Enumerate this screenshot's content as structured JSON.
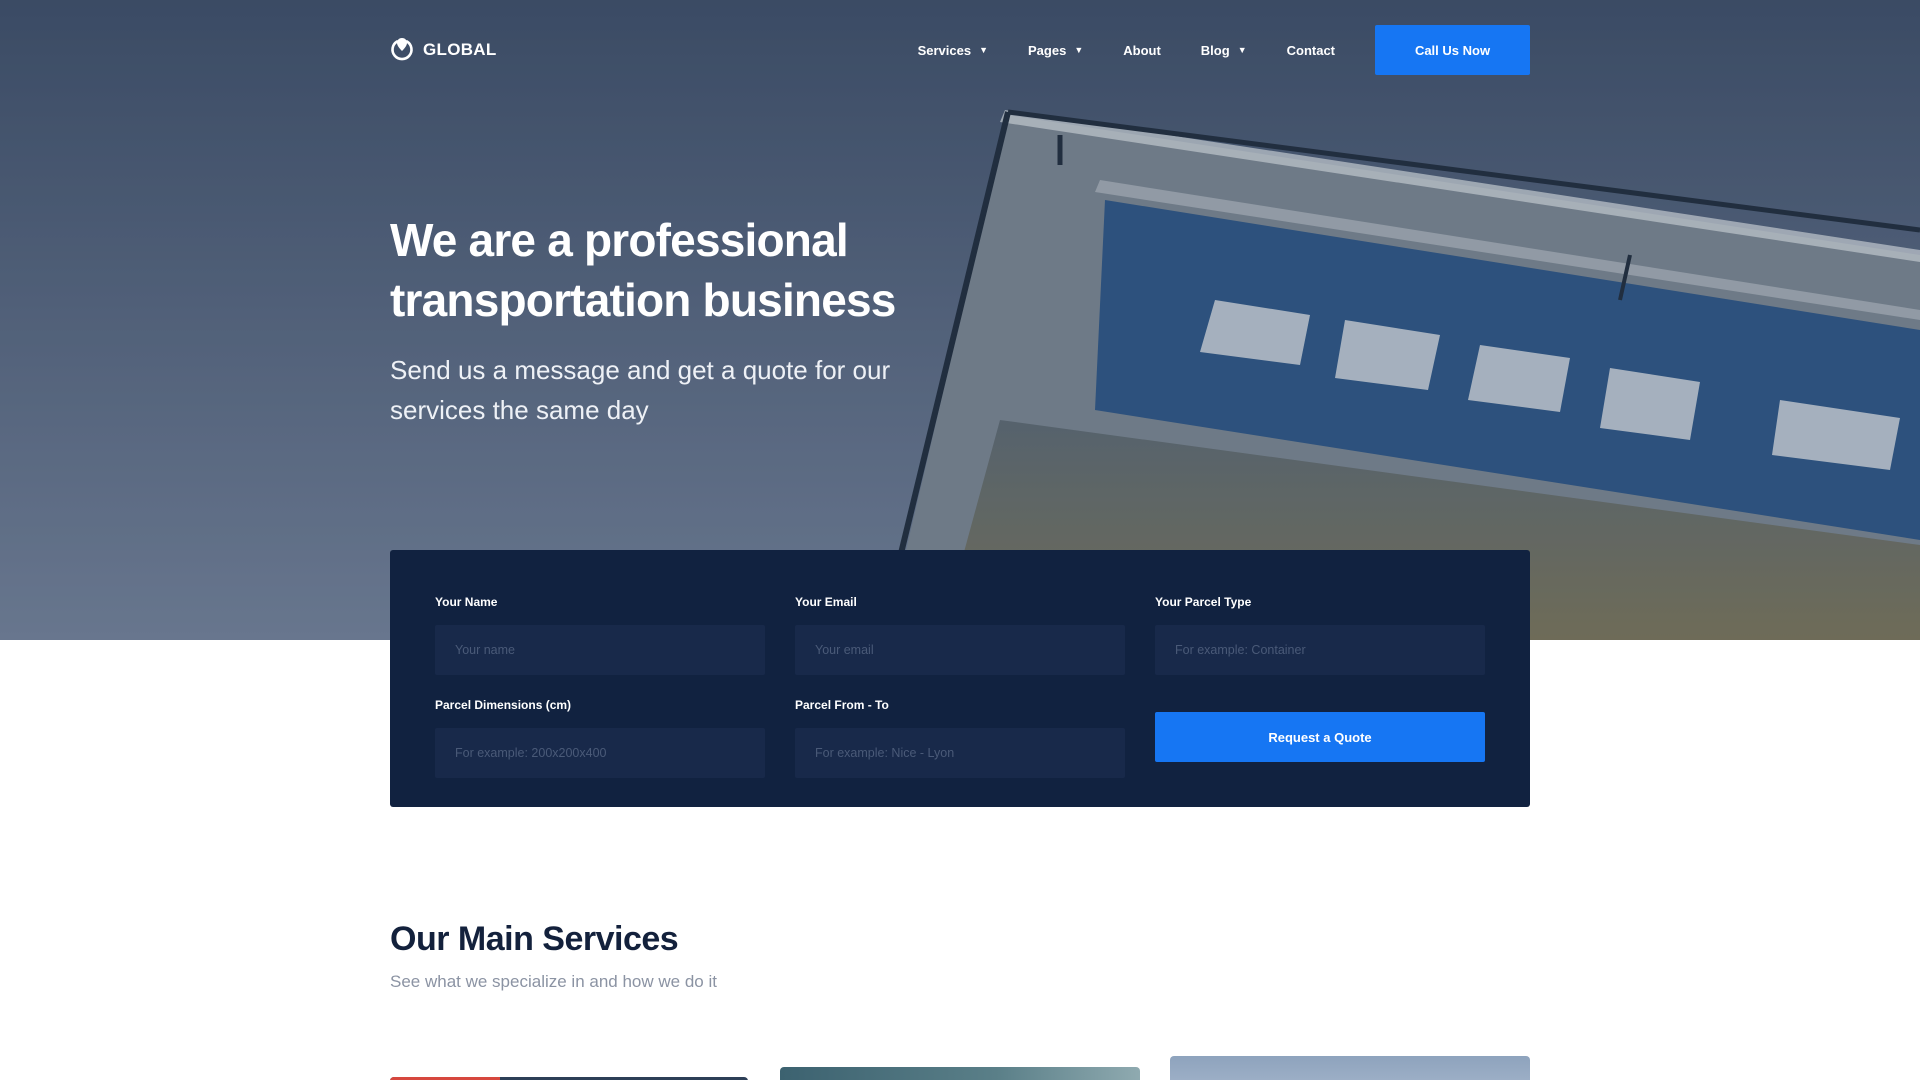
{
  "brand": {
    "name": "GLOBAL",
    "icon": "location-pin-icon"
  },
  "nav": {
    "items": [
      {
        "label": "Services",
        "dropdown": true
      },
      {
        "label": "Pages",
        "dropdown": true
      },
      {
        "label": "About",
        "dropdown": false
      },
      {
        "label": "Blog",
        "dropdown": true
      },
      {
        "label": "Contact",
        "dropdown": false
      }
    ],
    "caret": "▼",
    "cta_label": "Call Us Now"
  },
  "hero": {
    "title": "We are a professional transportation business",
    "subtitle": "Send us a message and get a quote for our services the same day"
  },
  "quote_form": {
    "fields": [
      {
        "label": "Your Name",
        "placeholder": "Your name",
        "value": ""
      },
      {
        "label": "Your Email",
        "placeholder": "Your email",
        "value": ""
      },
      {
        "label": "Your Parcel Type",
        "placeholder": "For example: Container",
        "value": ""
      },
      {
        "label": "Parcel Dimensions (cm)",
        "placeholder": "For example: 200x200x400",
        "value": ""
      },
      {
        "label": "Parcel From - To",
        "placeholder": "For example: Nice - Lyon",
        "value": ""
      }
    ],
    "submit_label": "Request a Quote"
  },
  "services": {
    "title": "Our Main Services",
    "subtitle": "See what we specialize in and how we do it"
  },
  "colors": {
    "accent": "#1676f3",
    "form_background": "#112240",
    "heading": "#13213c",
    "muted_text": "#8b93a3"
  }
}
